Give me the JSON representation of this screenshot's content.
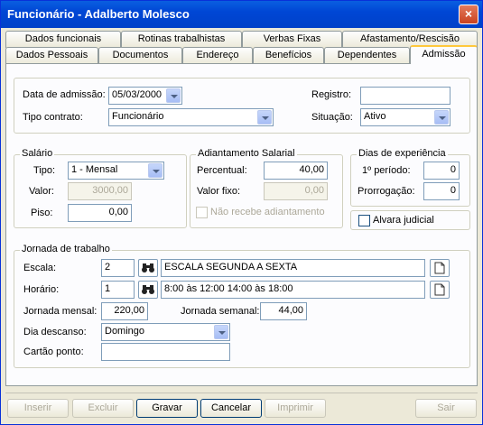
{
  "window": {
    "title": "Funcionário - Adalberto Molesco",
    "close_symbol": "×"
  },
  "tabs_top": [
    {
      "label": "Dados funcionais"
    },
    {
      "label": "Rotinas trabalhistas"
    },
    {
      "label": "Verbas Fixas"
    },
    {
      "label": "Afastamento/Rescisão"
    }
  ],
  "tabs_bottom": [
    {
      "label": "Dados Pessoais"
    },
    {
      "label": "Documentos"
    },
    {
      "label": "Endereço"
    },
    {
      "label": "Benefícios"
    },
    {
      "label": "Dependentes"
    },
    {
      "label": "Admissão",
      "active": true
    }
  ],
  "admissao": {
    "data_label": "Data de admissão:",
    "data_value": "05/03/2000",
    "tipo_label": "Tipo contrato:",
    "tipo_value": "Funcionário",
    "registro_label": "Registro:",
    "registro_value": "",
    "situacao_label": "Situação:",
    "situacao_value": "Ativo"
  },
  "salario": {
    "title": "Salário",
    "tipo_label": "Tipo:",
    "tipo_value": "1 - Mensal",
    "valor_label": "Valor:",
    "valor_value": "3000,00",
    "piso_label": "Piso:",
    "piso_value": "0,00"
  },
  "adiantamento": {
    "title": "Adiantamento Salarial",
    "percentual_label": "Percentual:",
    "percentual_value": "40,00",
    "valor_fixo_label": "Valor fixo:",
    "valor_fixo_value": "0,00",
    "nao_recebe_label": "Não recebe adiantamento"
  },
  "experiencia": {
    "title": "Dias de experiência",
    "primeiro_label": "1º período:",
    "primeiro_value": "0",
    "prorrogacao_label": "Prorrogação:",
    "prorrogacao_value": "0"
  },
  "alvara": {
    "label": "Alvara judicial"
  },
  "jornada": {
    "title": "Jornada de trabalho",
    "escala_label": "Escala:",
    "escala_code": "2",
    "escala_desc": "ESCALA SEGUNDA A SEXTA",
    "horario_label": "Horário:",
    "horario_code": "1",
    "horario_desc": "8:00 às 12:00  14:00 às 18:00",
    "mensal_label": "Jornada mensal:",
    "mensal_value": "220,00",
    "semanal_label": "Jornada semanal:",
    "semanal_value": "44,00",
    "descanso_label": "Dia descanso:",
    "descanso_value": "Domingo",
    "cartao_label": "Cartão ponto:",
    "cartao_value": ""
  },
  "buttons": {
    "inserir": "Inserir",
    "excluir": "Excluir",
    "gravar": "Gravar",
    "cancelar": "Cancelar",
    "imprimir": "Imprimir",
    "sair": "Sair"
  },
  "icons": {
    "search": "binoculars-icon",
    "detail": "document-icon"
  },
  "colors": {
    "title_bar": "#0046d5",
    "window_bg": "#ece9d8",
    "active_tab_accent": "#ffc83c"
  }
}
